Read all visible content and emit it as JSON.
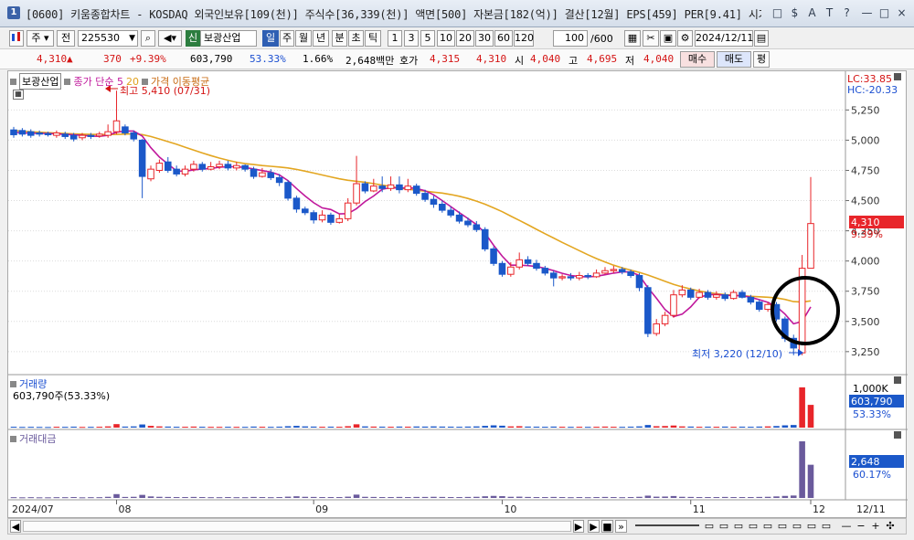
{
  "window": {
    "number": "1",
    "title": "[0600] 키움종합차트 - KOSDAQ 외국인보유[109(천)] 주식수[36,339(천)] 액면[500] 자본금[182(억)] 결산[12월] EPS[459] PER[9.41] 시가총액[1,5",
    "buttons": [
      "□",
      "$",
      "A",
      "T",
      "?",
      "—",
      "□",
      "×"
    ]
  },
  "toolbar": {
    "period": "주",
    "prev": "전",
    "code": "225530",
    "stock_badge": "신",
    "stock_name": "보광산업",
    "periods": [
      "일",
      "주",
      "월",
      "년",
      "분",
      "초",
      "틱"
    ],
    "intervals": [
      "1",
      "3",
      "5",
      "10",
      "20",
      "30",
      "60",
      "120"
    ],
    "count": "100",
    "count_max": "/600",
    "date": "2024/12/11"
  },
  "quote": {
    "price": "4,310",
    "arrow": "▲",
    "change": "370",
    "pct": "+9.39%",
    "volume": "603,790",
    "vol_ratio": "53.33%",
    "turnover": "1.66%",
    "amount": "2,648백만",
    "ask_label": "호가",
    "ask": "4,315",
    "bid": "4,310",
    "open_label": "시",
    "open": "4,040",
    "high_label": "고",
    "high": "4,695",
    "low_label": "저",
    "low": "4,040",
    "buy": "매수",
    "sell": "매도",
    "flat": "평"
  },
  "chart_legend": {
    "stock": "보광산업",
    "ma_text": "종가 단순 5",
    "ma20": "20",
    "ma_suffix": "가격 이동평균",
    "lc": "LC:33.85",
    "hc": "HC:-20.33",
    "high_note": "최고 5,410 (07/31)",
    "low_note": "최저 3,220 (12/10)",
    "price_label": "4,310",
    "pct_label": "9.39%"
  },
  "volume_panel": {
    "title": "거래량",
    "value": "603,790주(53.33%)",
    "axis_top": "1,000K",
    "label": "603,790",
    "pct": "53.33%"
  },
  "amount_panel": {
    "title": "거래대금",
    "label": "2,648",
    "pct": "60.17%"
  },
  "date_axis": {
    "labels": [
      "2024/07",
      "08",
      "09",
      "10",
      "11",
      "12"
    ],
    "right": "12/11"
  },
  "chart_data": {
    "type": "candlestick",
    "yticks": [
      5250,
      5000,
      4750,
      4500,
      4250,
      4000,
      3750,
      3500,
      3250
    ],
    "ylim": [
      3090,
      5540
    ],
    "candles": [
      [
        5085,
        5045,
        5110,
        5020
      ],
      [
        5080,
        5050,
        5100,
        5030
      ],
      [
        5070,
        5040,
        5090,
        5020
      ],
      [
        5060,
        5050,
        5080,
        5030
      ],
      [
        5055,
        5045,
        5070,
        5030
      ],
      [
        5040,
        5060,
        5080,
        5020
      ],
      [
        5050,
        5030,
        5070,
        5010
      ],
      [
        5040,
        5010,
        5060,
        4990
      ],
      [
        5020,
        5040,
        5060,
        5000
      ],
      [
        5040,
        5030,
        5060,
        5010
      ],
      [
        5035,
        5050,
        5070,
        5020
      ],
      [
        5040,
        5070,
        5130,
        5020
      ],
      [
        5070,
        5160,
        5410,
        5050
      ],
      [
        5110,
        5060,
        5130,
        5040
      ],
      [
        5060,
        5010,
        5080,
        4990
      ],
      [
        5000,
        4700,
        5010,
        4520
      ],
      [
        4680,
        4760,
        4790,
        4660
      ],
      [
        4750,
        4810,
        4840,
        4730
      ],
      [
        4820,
        4750,
        4860,
        4730
      ],
      [
        4760,
        4720,
        4790,
        4700
      ],
      [
        4720,
        4760,
        4790,
        4700
      ],
      [
        4760,
        4800,
        4830,
        4740
      ],
      [
        4800,
        4760,
        4820,
        4740
      ],
      [
        4760,
        4780,
        4820,
        4750
      ],
      [
        4780,
        4800,
        4830,
        4760
      ],
      [
        4800,
        4770,
        4830,
        4750
      ],
      [
        4770,
        4790,
        4820,
        4750
      ],
      [
        4790,
        4760,
        4800,
        4740
      ],
      [
        4760,
        4700,
        4780,
        4680
      ],
      [
        4700,
        4730,
        4770,
        4690
      ],
      [
        4730,
        4690,
        4760,
        4670
      ],
      [
        4690,
        4650,
        4720,
        4620
      ],
      [
        4650,
        4520,
        4670,
        4500
      ],
      [
        4520,
        4430,
        4540,
        4400
      ],
      [
        4430,
        4400,
        4450,
        4380
      ],
      [
        4400,
        4340,
        4420,
        4310
      ],
      [
        4340,
        4380,
        4420,
        4320
      ],
      [
        4380,
        4320,
        4400,
        4300
      ],
      [
        4320,
        4350,
        4390,
        4310
      ],
      [
        4350,
        4480,
        4520,
        4330
      ],
      [
        4480,
        4640,
        4870,
        4460
      ],
      [
        4640,
        4580,
        4660,
        4560
      ],
      [
        4580,
        4620,
        4680,
        4570
      ],
      [
        4620,
        4600,
        4700,
        4570
      ],
      [
        4600,
        4630,
        4700,
        4580
      ],
      [
        4630,
        4590,
        4700,
        4560
      ],
      [
        4590,
        4620,
        4680,
        4570
      ],
      [
        4620,
        4560,
        4640,
        4540
      ],
      [
        4560,
        4510,
        4590,
        4490
      ],
      [
        4510,
        4470,
        4540,
        4440
      ],
      [
        4470,
        4420,
        4500,
        4400
      ],
      [
        4420,
        4380,
        4450,
        4360
      ],
      [
        4380,
        4330,
        4410,
        4310
      ],
      [
        4330,
        4300,
        4360,
        4280
      ],
      [
        4300,
        4260,
        4330,
        4240
      ],
      [
        4260,
        4100,
        4280,
        4080
      ],
      [
        4100,
        3980,
        4120,
        3960
      ],
      [
        3980,
        3890,
        4000,
        3870
      ],
      [
        3890,
        3950,
        3990,
        3870
      ],
      [
        3950,
        4010,
        4070,
        3930
      ],
      [
        4010,
        3980,
        4040,
        3960
      ],
      [
        3980,
        3940,
        4010,
        3920
      ],
      [
        3940,
        3900,
        3960,
        3880
      ],
      [
        3900,
        3860,
        3920,
        3790
      ],
      [
        3860,
        3870,
        3890,
        3840
      ],
      [
        3870,
        3860,
        3900,
        3840
      ],
      [
        3860,
        3880,
        3910,
        3840
      ],
      [
        3880,
        3870,
        3900,
        3850
      ],
      [
        3870,
        3900,
        3930,
        3860
      ],
      [
        3900,
        3920,
        3950,
        3890
      ],
      [
        3920,
        3930,
        3960,
        3900
      ],
      [
        3930,
        3910,
        3950,
        3890
      ],
      [
        3910,
        3880,
        3930,
        3860
      ],
      [
        3880,
        3780,
        3900,
        3750
      ],
      [
        3780,
        3400,
        3800,
        3370
      ],
      [
        3400,
        3480,
        3520,
        3380
      ],
      [
        3480,
        3550,
        3580,
        3460
      ],
      [
        3550,
        3720,
        3760,
        3530
      ],
      [
        3720,
        3760,
        3800,
        3700
      ],
      [
        3760,
        3700,
        3780,
        3680
      ],
      [
        3700,
        3740,
        3770,
        3690
      ],
      [
        3740,
        3700,
        3760,
        3680
      ],
      [
        3700,
        3720,
        3750,
        3680
      ],
      [
        3720,
        3690,
        3740,
        3670
      ],
      [
        3690,
        3740,
        3760,
        3680
      ],
      [
        3740,
        3700,
        3760,
        3690
      ],
      [
        3700,
        3660,
        3720,
        3640
      ],
      [
        3660,
        3600,
        3680,
        3580
      ],
      [
        3600,
        3640,
        3660,
        3580
      ],
      [
        3640,
        3520,
        3660,
        3500
      ],
      [
        3520,
        3360,
        3540,
        3330
      ],
      [
        3360,
        3280,
        3390,
        3220
      ],
      [
        3240,
        3940,
        4050,
        3220
      ],
      [
        3940,
        4310,
        4695,
        3940
      ]
    ],
    "ma5": [
      5066,
      5060,
      5058,
      5056,
      5055,
      5052,
      5048,
      5044,
      5040,
      5034,
      5032,
      5040,
      5066,
      5076,
      5076,
      5034,
      4938,
      4860,
      4802,
      4746,
      4742,
      4754,
      4762,
      4766,
      4776,
      4780,
      4780,
      4774,
      4762,
      4748,
      4736,
      4712,
      4666,
      4600,
      4538,
      4482,
      4440,
      4426,
      4390,
      4392,
      4434,
      4492,
      4538,
      4594,
      4608,
      4602,
      4608,
      4600,
      4582,
      4548,
      4500,
      4450,
      4400,
      4352,
      4302,
      4230,
      4130,
      4040,
      3966,
      3966,
      3962,
      3954,
      3940,
      3920,
      3898,
      3880,
      3872,
      3868,
      3874,
      3886,
      3900,
      3910,
      3910,
      3880,
      3780,
      3692,
      3598,
      3540,
      3560,
      3620,
      3700,
      3720,
      3724,
      3716,
      3714,
      3712,
      3700,
      3680,
      3658,
      3624,
      3560,
      3480,
      3500,
      3620
    ],
    "ma20": [
      5080,
      5075,
      5070,
      5066,
      5062,
      5058,
      5055,
      5052,
      5050,
      5048,
      5047,
      5046,
      5048,
      5050,
      5052,
      5046,
      5030,
      5010,
      4988,
      4966,
      4942,
      4918,
      4894,
      4872,
      4852,
      4834,
      4818,
      4806,
      4798,
      4790,
      4784,
      4778,
      4770,
      4758,
      4744,
      4728,
      4712,
      4696,
      4680,
      4668,
      4660,
      4652,
      4640,
      4628,
      4616,
      4604,
      4594,
      4586,
      4578,
      4570,
      4562,
      4550,
      4536,
      4518,
      4496,
      4470,
      4440,
      4408,
      4372,
      4336,
      4300,
      4262,
      4226,
      4190,
      4154,
      4120,
      4086,
      4052,
      4020,
      3992,
      3966,
      3944,
      3924,
      3906,
      3884,
      3858,
      3832,
      3806,
      3786,
      3768,
      3752,
      3740,
      3730,
      3722,
      3716,
      3712,
      3708,
      3704,
      3700,
      3694,
      3682,
      3664,
      3660,
      3670
    ],
    "volume": [
      10,
      8,
      9,
      8,
      7,
      10,
      9,
      11,
      8,
      9,
      10,
      14,
      40,
      12,
      14,
      36,
      20,
      14,
      12,
      10,
      10,
      12,
      10,
      9,
      9,
      10,
      9,
      9,
      12,
      10,
      9,
      11,
      16,
      20,
      14,
      12,
      10,
      11,
      10,
      16,
      38,
      14,
      12,
      11,
      10,
      12,
      11,
      13,
      12,
      14,
      12,
      11,
      10,
      12,
      14,
      20,
      26,
      22,
      14,
      16,
      12,
      11,
      10,
      12,
      10,
      9,
      10,
      9,
      10,
      12,
      10,
      9,
      11,
      14,
      30,
      16,
      18,
      24,
      14,
      12,
      10,
      11,
      10,
      12,
      10,
      11,
      10,
      12,
      14,
      18,
      26,
      30,
      460,
      260
    ],
    "amount": [
      6,
      5,
      6,
      5,
      5,
      6,
      6,
      7,
      5,
      6,
      6,
      9,
      30,
      8,
      9,
      24,
      12,
      9,
      8,
      7,
      7,
      8,
      7,
      6,
      6,
      7,
      6,
      6,
      8,
      7,
      6,
      7,
      10,
      13,
      9,
      8,
      7,
      7,
      7,
      10,
      26,
      9,
      8,
      7,
      7,
      8,
      7,
      8,
      8,
      9,
      8,
      7,
      7,
      8,
      9,
      13,
      16,
      14,
      9,
      10,
      8,
      7,
      7,
      8,
      7,
      6,
      7,
      6,
      7,
      8,
      7,
      6,
      7,
      9,
      18,
      10,
      11,
      15,
      9,
      8,
      7,
      7,
      7,
      8,
      7,
      7,
      7,
      8,
      9,
      12,
      16,
      19,
      440,
      258
    ]
  }
}
